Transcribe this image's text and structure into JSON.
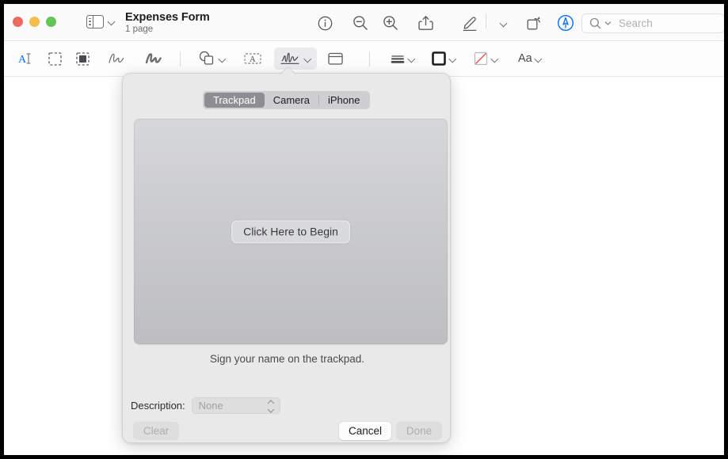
{
  "window": {
    "title": "Expenses Form",
    "subtitle": "1 page",
    "traffic_lights": [
      {
        "name": "close",
        "color": "#ec6a5f"
      },
      {
        "name": "minimize",
        "color": "#f4bd50"
      },
      {
        "name": "zoom",
        "color": "#61c454"
      }
    ]
  },
  "toolbar": {
    "sidebar_label": "sidebar-toggle",
    "items": [
      {
        "name": "info-icon",
        "label": "Info"
      },
      {
        "name": "zoom-out-icon",
        "label": "Zoom Out"
      },
      {
        "name": "zoom-in-icon",
        "label": "Zoom In"
      },
      {
        "name": "share-icon",
        "label": "Share"
      },
      {
        "name": "markup-icon",
        "label": "Show Markup Toolbar"
      },
      {
        "name": "rotate-icon",
        "label": "Rotate"
      },
      {
        "name": "annotate-icon",
        "label": "Annotate"
      }
    ]
  },
  "search": {
    "placeholder": "Search",
    "value": ""
  },
  "markup_toolbar": {
    "tools": [
      {
        "name": "text-selection-tool",
        "label": "Text Selection"
      },
      {
        "name": "rectangular-selection-tool",
        "label": "Rectangular Selection"
      },
      {
        "name": "instant-alpha-tool",
        "label": "Instant Alpha"
      },
      {
        "name": "sketch-tool",
        "label": "Sketch"
      },
      {
        "name": "draw-tool",
        "label": "Draw"
      },
      {
        "name": "shapes-tool",
        "label": "Shapes"
      },
      {
        "name": "text-tool",
        "label": "Text"
      },
      {
        "name": "signature-tool",
        "label": "Sign",
        "active": true
      },
      {
        "name": "note-tool",
        "label": "Note"
      },
      {
        "name": "shape-style-tool",
        "label": "Shape Style"
      },
      {
        "name": "border-color-tool",
        "label": "Border Color"
      },
      {
        "name": "fill-color-tool",
        "label": "Fill Color"
      },
      {
        "name": "text-style-tool",
        "label": "Aa"
      }
    ],
    "text_style_label": "Aa"
  },
  "signature_popover": {
    "tabs": [
      {
        "label": "Trackpad",
        "selected": true
      },
      {
        "label": "Camera",
        "selected": false
      },
      {
        "label": "iPhone",
        "selected": false
      }
    ],
    "begin_button": "Click Here to Begin",
    "hint": "Sign your name on the trackpad.",
    "description_label": "Description:",
    "description_value": "None",
    "buttons": {
      "clear": "Clear",
      "cancel": "Cancel",
      "done": "Done"
    }
  },
  "colors": {
    "selected_segment": "#8e8e92",
    "popover_background": "#e9e9e9",
    "trackpad_top": "#d6d7d9",
    "trackpad_bottom": "#bdbec0",
    "accent": "#0a6cff"
  }
}
